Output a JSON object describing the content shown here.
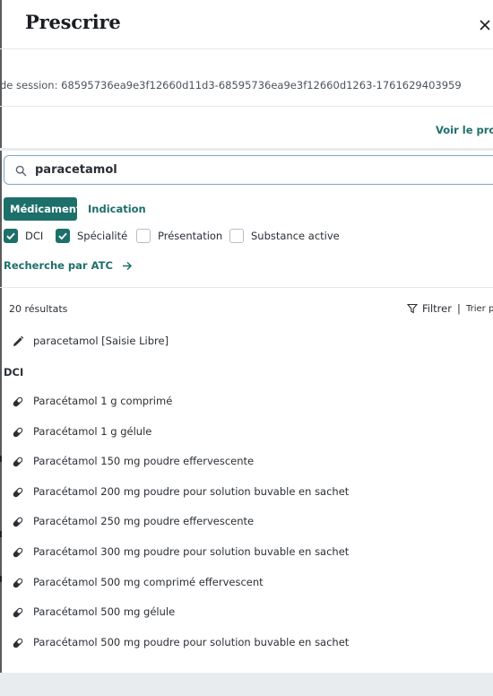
{
  "header": {
    "title": "Prescrire",
    "close_icon": "close-icon"
  },
  "session": {
    "text": "de session: 68595736ea9e3f12660d11d3-68595736ea9e3f12660d1263-1761629403959"
  },
  "profile": {
    "link_label": "Voir le profil"
  },
  "search": {
    "value": "paracetamol",
    "icon": "search-icon"
  },
  "search_type": {
    "active": "Médicament",
    "inactive": "Indication"
  },
  "filters": [
    {
      "label": "DCI",
      "checked": true
    },
    {
      "label": "Spécialité",
      "checked": true
    },
    {
      "label": "Présentation",
      "checked": false
    },
    {
      "label": "Substance active",
      "checked": false
    }
  ],
  "atc": {
    "label": "Recherche par ATC"
  },
  "results": {
    "count_label": "20 résultats",
    "filter_label": "Filtrer",
    "separator": "|",
    "sort_label": "Trier par"
  },
  "free_entry": {
    "label": "paracetamol [Saisie Libre]",
    "icon": "pencil-icon"
  },
  "dci_section": {
    "title": "DCI"
  },
  "items": [
    {
      "label": "Paracétamol 1 g comprimé",
      "icon": "pill-icon"
    },
    {
      "label": "Paracétamol 1 g gélule",
      "icon": "pill-icon"
    },
    {
      "label": "Paracétamol 150 mg poudre effervescente",
      "icon": "pill-icon"
    },
    {
      "label": "Paracétamol 200 mg poudre pour solution buvable en sachet",
      "icon": "pill-icon"
    },
    {
      "label": "Paracétamol 250 mg poudre effervescente",
      "icon": "pill-icon"
    },
    {
      "label": "Paracétamol 300 mg poudre pour solution buvable en sachet",
      "icon": "pill-icon"
    },
    {
      "label": "Paracétamol 500 mg comprimé effervescent",
      "icon": "pill-icon"
    },
    {
      "label": "Paracétamol 500 mg gélule",
      "icon": "pill-icon"
    },
    {
      "label": "Paracétamol 500 mg poudre pour solution buvable en sachet",
      "icon": "pill-icon"
    }
  ],
  "colors": {
    "accent": "#1d6f6a",
    "search_border": "#7fa7c9",
    "text": "#2a2f35"
  }
}
